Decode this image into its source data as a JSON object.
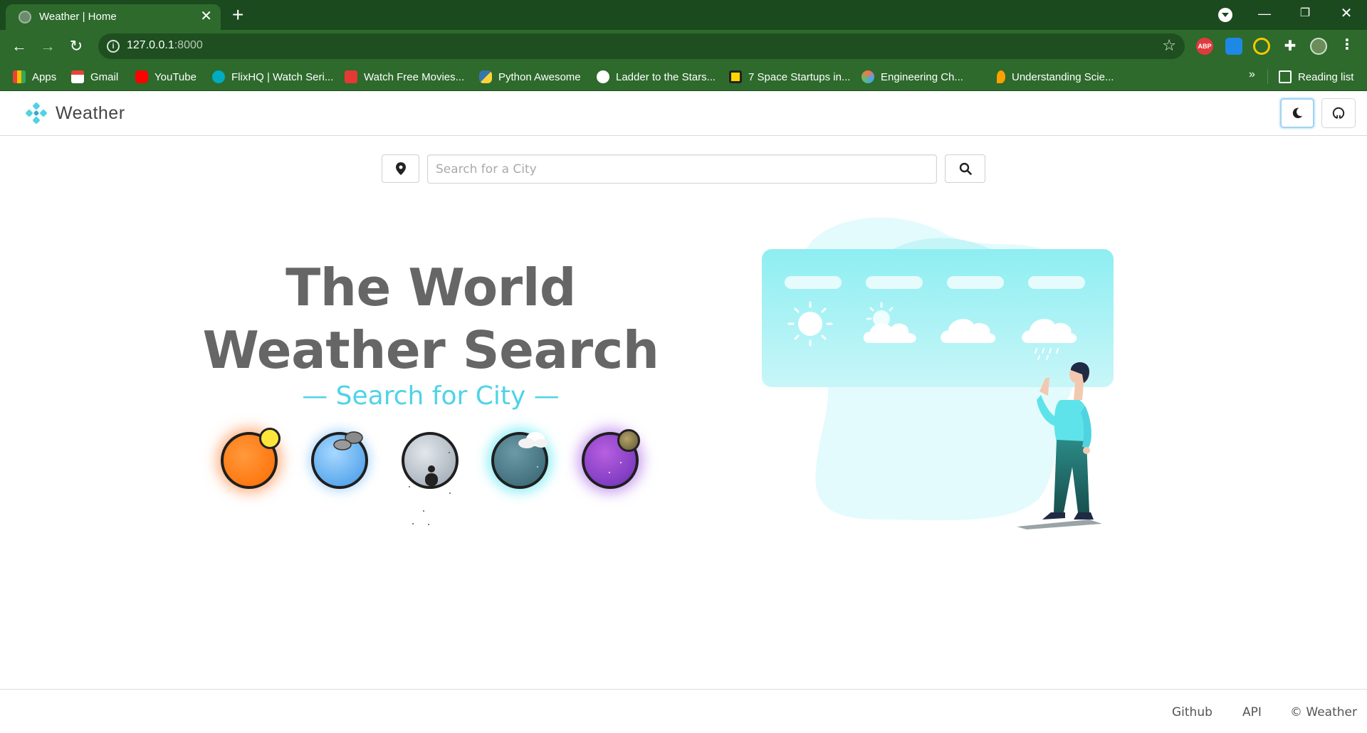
{
  "browser": {
    "tab_title": "Weather | Home",
    "url_host": "127.0.0.1",
    "url_port": ":8000",
    "bookmarks": [
      {
        "label": "Apps",
        "icon": "apps-grid-icon",
        "color": "#e94235"
      },
      {
        "label": "Gmail",
        "icon": "gmail-icon",
        "color": "#ea4335"
      },
      {
        "label": "YouTube",
        "icon": "youtube-icon",
        "color": "#ff0000"
      },
      {
        "label": "FlixHQ | Watch Seri...",
        "icon": "flixhq-icon",
        "color": "#00acc1"
      },
      {
        "label": "Watch Free Movies...",
        "icon": "movies-icon",
        "color": "#e53935"
      },
      {
        "label": "Python Awesome",
        "icon": "python-icon",
        "color": "#3776ab"
      },
      {
        "label": "Ladder to the Stars...",
        "icon": "rocket-icon",
        "color": "#ffffff"
      },
      {
        "label": "7 Space Startups in...",
        "icon": "startup-icon",
        "color": "#ffd600"
      },
      {
        "label": "Engineering Ch...",
        "icon": "gear-icon",
        "color": "#ff7043"
      },
      {
        "label": "Understanding Scie...",
        "icon": "flame-icon",
        "color": "#ffa000"
      }
    ],
    "reading_list": "Reading list",
    "more_bookmarks": "»",
    "extensions": [
      {
        "icon": "adblock-icon",
        "label": "ABP",
        "color": "#e03a3e"
      },
      {
        "icon": "share-extension-icon",
        "label": "",
        "color": "#1e88e5"
      },
      {
        "icon": "coin-extension-icon",
        "label": "",
        "color": "#f6c900"
      },
      {
        "icon": "puzzle-extensions-icon",
        "label": "",
        "color": "#ffffff"
      }
    ]
  },
  "app": {
    "brand": "Weather",
    "search": {
      "placeholder": "Search for a City",
      "value": ""
    },
    "hero": {
      "line1": "The World",
      "line2": "Weather Search",
      "subtitle": "— Search for City —"
    },
    "orbs": [
      {
        "name": "sunny-orb"
      },
      {
        "name": "cloudy-orb"
      },
      {
        "name": "fog-orb"
      },
      {
        "name": "night-cloud-orb"
      },
      {
        "name": "night-moon-orb"
      }
    ],
    "illustration": {
      "name": "weather-forecast-illustration"
    }
  },
  "footer": {
    "links": [
      "Github",
      "API"
    ],
    "copyright": "© Weather"
  },
  "colors": {
    "accent": "#4fd3e6",
    "chrome_dark": "#1b4a1f",
    "chrome": "#2d6a2c",
    "heading": "#666666"
  }
}
